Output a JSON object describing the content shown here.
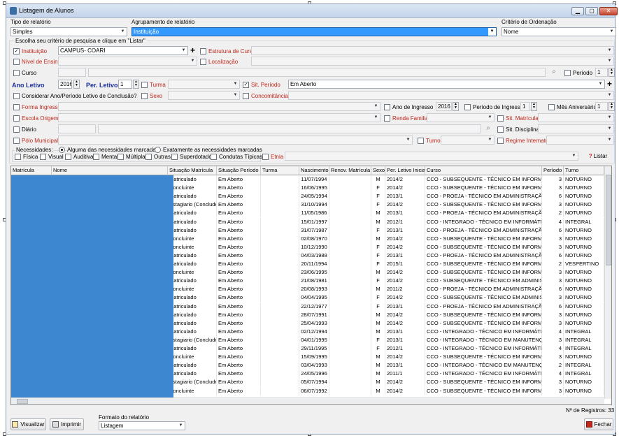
{
  "window": {
    "title": "Listagem de Alunos",
    "min": "▁",
    "max": "▢",
    "close": "✕"
  },
  "tipo": {
    "label": "Tipo de relatório",
    "value": "Simples"
  },
  "agrup": {
    "label": "Agrupamento de relatório",
    "value": "Instituição"
  },
  "criterio": {
    "label": "Critério de Ordenação",
    "value": "Nome"
  },
  "group_title": "Escolha seu critério de pesquisa e clique em \"Listar\"",
  "fields": {
    "instituicao": {
      "label": "Instituição",
      "value": "CAMPUS- COARI"
    },
    "estrutura": {
      "label": "Estrutura de Curso"
    },
    "nivel": {
      "label": "Nível de Ensino"
    },
    "localizacao": {
      "label": "Localização"
    },
    "curso": {
      "label": "Curso"
    },
    "periodo": {
      "label": "Período",
      "value": "1"
    },
    "ano_letivo": {
      "label": "Ano Letivo",
      "value": "2016"
    },
    "per_letivo": {
      "label": "Per. Letivo",
      "value": "1"
    },
    "turma": {
      "label": "Turma"
    },
    "sit_periodo": {
      "label": "Sit. Período",
      "value": "Em Aberto"
    },
    "considerar": {
      "label": "Considerar Ano/Período Letivo de Conclusão?"
    },
    "sexo": {
      "label": "Sexo"
    },
    "concomitancia": {
      "label": "Concomitância"
    },
    "forma_ingresso": {
      "label": "Forma Ingresso"
    },
    "ano_ingresso": {
      "label": "Ano de Ingresso",
      "value": "2016"
    },
    "per_ingresso": {
      "label": "Período de Ingresso",
      "value": "1"
    },
    "mes_aniv": {
      "label": "Mês Aniversário",
      "value": "1"
    },
    "escola_origem": {
      "label": "Escola Origem"
    },
    "renda": {
      "label": "Renda Familiar"
    },
    "sit_matricula": {
      "label": "Sit. Matrícula"
    },
    "diario": {
      "label": "Diário"
    },
    "sit_disciplina": {
      "label": "Sit. Disciplina"
    },
    "polo": {
      "label": "Pólo Municipal"
    },
    "turno": {
      "label": "Turno"
    },
    "regime": {
      "label": "Regime Internato"
    },
    "necessidades": {
      "label": "Necessidades:",
      "opt1": "Alguma das necessidades marcadas",
      "opt2": "Exatamente as necessidades marcadas"
    },
    "nec_list": [
      "Física",
      "Visual",
      "Auditiva",
      "Mental",
      "Múltipla",
      "Outras",
      "Superdotado",
      "Condutas Típicas"
    ],
    "etnia": {
      "label": "Etnia"
    },
    "listar": "Listar"
  },
  "grid": {
    "headers": [
      "Matrícula",
      "Nome",
      "Situação Matrícula",
      "Situação Período",
      "Turma",
      "Nascimento",
      "Renov. Matrícula",
      "Sexo",
      "Per. Letivo Inicial",
      "Curso",
      "Período",
      "Turno"
    ],
    "rows": [
      [
        "Matriculado",
        "Em Aberto",
        "11/07/1994",
        "M",
        "2014/2",
        "CCO - SUBSEQUENTE - TÉCNICO EM INFORMÁT",
        "3",
        "NOTURNO"
      ],
      [
        "Concluinte",
        "Em Aberto",
        "16/06/1995",
        "F",
        "2014/2",
        "CCO - SUBSEQUENTE - TÉCNICO EM INFORMÁT",
        "3",
        "NOTURNO"
      ],
      [
        "Matriculado",
        "Em Aberto",
        "24/05/1994",
        "F",
        "2013/1",
        "CCO - PROEJA - TÉCNICO EM ADMINISTRAÇÃO",
        "6",
        "NOTURNO"
      ],
      [
        "Estagiario (Concluden",
        "Em Aberto",
        "31/10/1994",
        "F",
        "2014/2",
        "CCO - SUBSEQUENTE - TÉCNICO EM INFORMÁT",
        "3",
        "NOTURNO"
      ],
      [
        "Matriculado",
        "Em Aberto",
        "11/05/1986",
        "M",
        "2013/1",
        "CCO - PROEJA - TÉCNICO EM ADMINISTRAÇÃO",
        "2",
        "NOTURNO"
      ],
      [
        "Matriculado",
        "Em Aberto",
        "15/01/1997",
        "M",
        "2012/1",
        "CCO - INTEGRADO - TÉCNICO EM INFORMÁTICA",
        "4",
        "INTEGRAL"
      ],
      [
        "Matriculado",
        "Em Aberto",
        "31/07/1987",
        "F",
        "2013/1",
        "CCO - PROEJA - TÉCNICO EM ADMINISTRAÇÃO",
        "6",
        "NOTURNO"
      ],
      [
        "Concluinte",
        "Em Aberto",
        "02/08/1970",
        "M",
        "2014/2",
        "CCO - SUBSEQUENTE - TÉCNICO EM INFORMÁT",
        "3",
        "NOTURNO"
      ],
      [
        "Concluinte",
        "Em Aberto",
        "10/12/1990",
        "F",
        "2014/2",
        "CCO - SUBSEQUENTE - TÉCNICO EM INFORMÁT",
        "3",
        "NOTURNO"
      ],
      [
        "Matriculado",
        "Em Aberto",
        "04/03/1988",
        "F",
        "2013/1",
        "CCO - PROEJA - TÉCNICO EM ADMINISTRAÇÃO",
        "6",
        "NOTURNO"
      ],
      [
        "Matriculado",
        "Em Aberto",
        "20/11/1994",
        "F",
        "2015/1",
        "CCO - SUBSEQUENTE - TÉCNICO EM INFORMÁT",
        "2",
        "VESPERTINO"
      ],
      [
        "Concluinte",
        "Em Aberto",
        "23/06/1995",
        "M",
        "2014/2",
        "CCO - SUBSEQUENTE - TÉCNICO EM INFORMÁT",
        "3",
        "NOTURNO"
      ],
      [
        "Matriculado",
        "Em Aberto",
        "21/08/1981",
        "F",
        "2014/2",
        "CCO - SUBSEQUENTE - TÉCNICO EM ADMINISTF",
        "3",
        "NOTURNO"
      ],
      [
        "Concluinte",
        "Em Aberto",
        "20/08/1993",
        "M",
        "2011/2",
        "CCO - PROEJA - TÉCNICO EM ADMINISTRAÇÃO",
        "6",
        "NOTURNO"
      ],
      [
        "Matriculado",
        "Em Aberto",
        "04/04/1995",
        "F",
        "2014/2",
        "CCO - SUBSEQUENTE - TÉCNICO EM ADMINISTF",
        "3",
        "NOTURNO"
      ],
      [
        "Matriculado",
        "Em Aberto",
        "22/12/1977",
        "F",
        "2013/1",
        "CCO - PROEJA - TÉCNICO EM ADMINISTRAÇÃO",
        "6",
        "NOTURNO"
      ],
      [
        "Matriculado",
        "Em Aberto",
        "28/07/1991",
        "M",
        "2014/2",
        "CCO - SUBSEQUENTE - TÉCNICO EM INFORMÁT",
        "3",
        "NOTURNO"
      ],
      [
        "Matriculado",
        "Em Aberto",
        "25/04/1993",
        "M",
        "2014/2",
        "CCO - SUBSEQUENTE - TÉCNICO EM INFORMÁT",
        "3",
        "NOTURNO"
      ],
      [
        "Matriculado",
        "Em Aberto",
        "02/12/1994",
        "M",
        "2013/1",
        "CCO - INTEGRADO - TÉCNICO EM INFORMÁTICA",
        "4",
        "INTEGRAL"
      ],
      [
        "Estagiario (Concluden",
        "Em Aberto",
        "04/01/1995",
        "F",
        "2013/1",
        "CCO - INTEGRADO - TÉCNICO EM MANUTENÇÃC",
        "3",
        "INTEGRAL"
      ],
      [
        "Matriculado",
        "Em Aberto",
        "29/11/1995",
        "F",
        "2012/1",
        "CCO - INTEGRADO - TÉCNICO EM INFORMÁTICA",
        "4",
        "INTEGRAL"
      ],
      [
        "Concluinte",
        "Em Aberto",
        "15/09/1995",
        "M",
        "2014/2",
        "CCO - SUBSEQUENTE - TÉCNICO EM INFORMÁT",
        "3",
        "NOTURNO"
      ],
      [
        "Matriculado",
        "Em Aberto",
        "03/04/1993",
        "M",
        "2013/1",
        "CCO - INTEGRADO - TÉCNICO EM MANUTENÇÃC",
        "2",
        "INTEGRAL"
      ],
      [
        "Matriculado",
        "Em Aberto",
        "24/05/1996",
        "M",
        "2011/1",
        "CCO - INTEGRADO - TÉCNICO EM INFORMÁTICA",
        "4",
        "INTEGRAL"
      ],
      [
        "Estagiario (Concluden",
        "Em Aberto",
        "05/07/1994",
        "M",
        "2014/2",
        "CCO - SUBSEQUENTE - TÉCNICO EM INFORMÁT",
        "3",
        "NOTURNO"
      ],
      [
        "Concluinte",
        "Em Aberto",
        "06/07/1992",
        "M",
        "2014/2",
        "CCO - SUBSEQUENTE - TÉCNICO EM INFORMÁT",
        "3",
        "NOTURNO"
      ]
    ]
  },
  "registros": "Nº de Registros: 33",
  "footer": {
    "visualizar": "Visualizar",
    "imprimir": "Imprimir",
    "formato_label": "Formato do relatório",
    "formato_value": "Listagem",
    "fechar": "Fechar"
  },
  "colors": {
    "accent": "#3399ff",
    "required": "#c0271b",
    "mask": "#3d86d0"
  }
}
